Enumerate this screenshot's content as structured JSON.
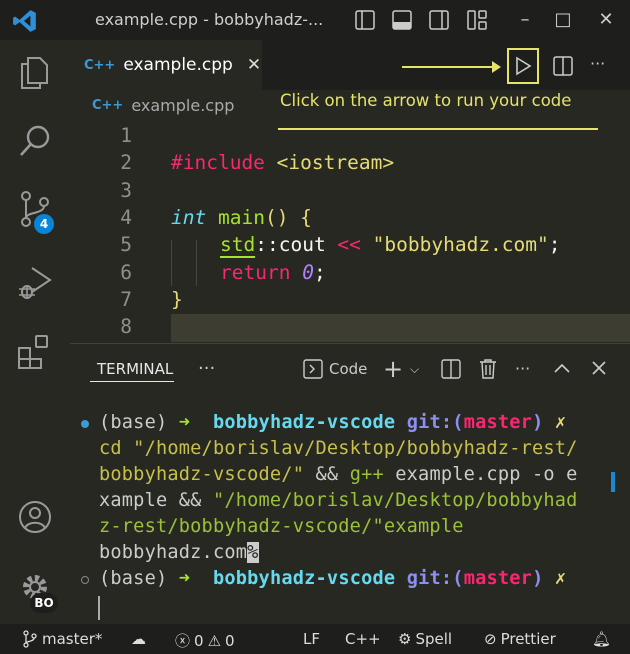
{
  "window": {
    "title": "example.cpp - bobbyhadz-...",
    "minimize": "–",
    "maximize": "□",
    "close": "✕"
  },
  "tab": {
    "icon": "C++",
    "label": "example.cpp",
    "close": "✕"
  },
  "breadcrumb": {
    "icon": "C++",
    "label": "example.cpp"
  },
  "annotation": {
    "text": "Click on the arrow to run your code",
    "color": "#e6e36a"
  },
  "activity": {
    "scm_badge": "4",
    "account_badge": "BO"
  },
  "editor": {
    "line_numbers": [
      "1",
      "2",
      "3",
      "4",
      "5",
      "6",
      "7",
      "8"
    ],
    "lines": {
      "l2": [
        {
          "t": "#include",
          "c": "pink"
        },
        {
          "t": " <iostream>",
          "c": "yel"
        }
      ],
      "l4": [
        {
          "t": "int",
          "c": "cy",
          "i": true
        },
        {
          "t": " ",
          "c": "wh"
        },
        {
          "t": "main",
          "c": "grn"
        },
        {
          "t": "() {",
          "c": "yel"
        }
      ],
      "l5": [
        {
          "t": "std",
          "c": "grn",
          "u": true
        },
        {
          "t": "::",
          "c": "wh"
        },
        {
          "t": "cout ",
          "c": "wh"
        },
        {
          "t": "<< ",
          "c": "pink"
        },
        {
          "t": "\"bobbyhadz.com\"",
          "c": "yel"
        },
        {
          "t": ";",
          "c": "wh"
        }
      ],
      "l6": [
        {
          "t": "return ",
          "c": "pink"
        },
        {
          "t": "0",
          "c": "pur",
          "i": true
        },
        {
          "t": ";",
          "c": "wh"
        }
      ],
      "l7": [
        {
          "t": "}",
          "c": "yel"
        }
      ]
    }
  },
  "terminal": {
    "tab": "TERMINAL",
    "more": "···",
    "profile": "Code",
    "prompt": {
      "base": "(base)",
      "arrow": "➜",
      "dir": "bobbyhadz-vscode",
      "git": "git:(",
      "branch": "master",
      "close": ")",
      "dirty": "✗"
    },
    "cmd_lines": [
      [
        {
          "t": "cd \"/home/borislav/Desktop/bobbyhadz-rest/",
          "c": "#c7c04a"
        }
      ],
      [
        {
          "t": "bobbyhadz-vscode/\"",
          "c": "#c7c04a"
        },
        {
          "t": " && ",
          "c": "#cccccc"
        },
        {
          "t": "g++",
          "c": "#9cc13a"
        },
        {
          "t": " example.cpp -o e",
          "c": "#cccccc"
        }
      ],
      [
        {
          "t": "xample",
          "c": "#cccccc"
        },
        {
          "t": " && ",
          "c": "#cccccc"
        },
        {
          "t": "\"/home/borislav/Desktop/bobbyhad",
          "c": "#9cc13a"
        }
      ],
      [
        {
          "t": "z-rest/bobbyhadz-vscode/\"example",
          "c": "#9cc13a"
        }
      ]
    ],
    "output": "bobbyhadz.com",
    "eol_mark": "%"
  },
  "status": {
    "branch": "master*",
    "errors": "0",
    "warnings": "0",
    "eol": "LF",
    "language": "C++",
    "spell": "Spell",
    "prettier": "Prettier"
  }
}
